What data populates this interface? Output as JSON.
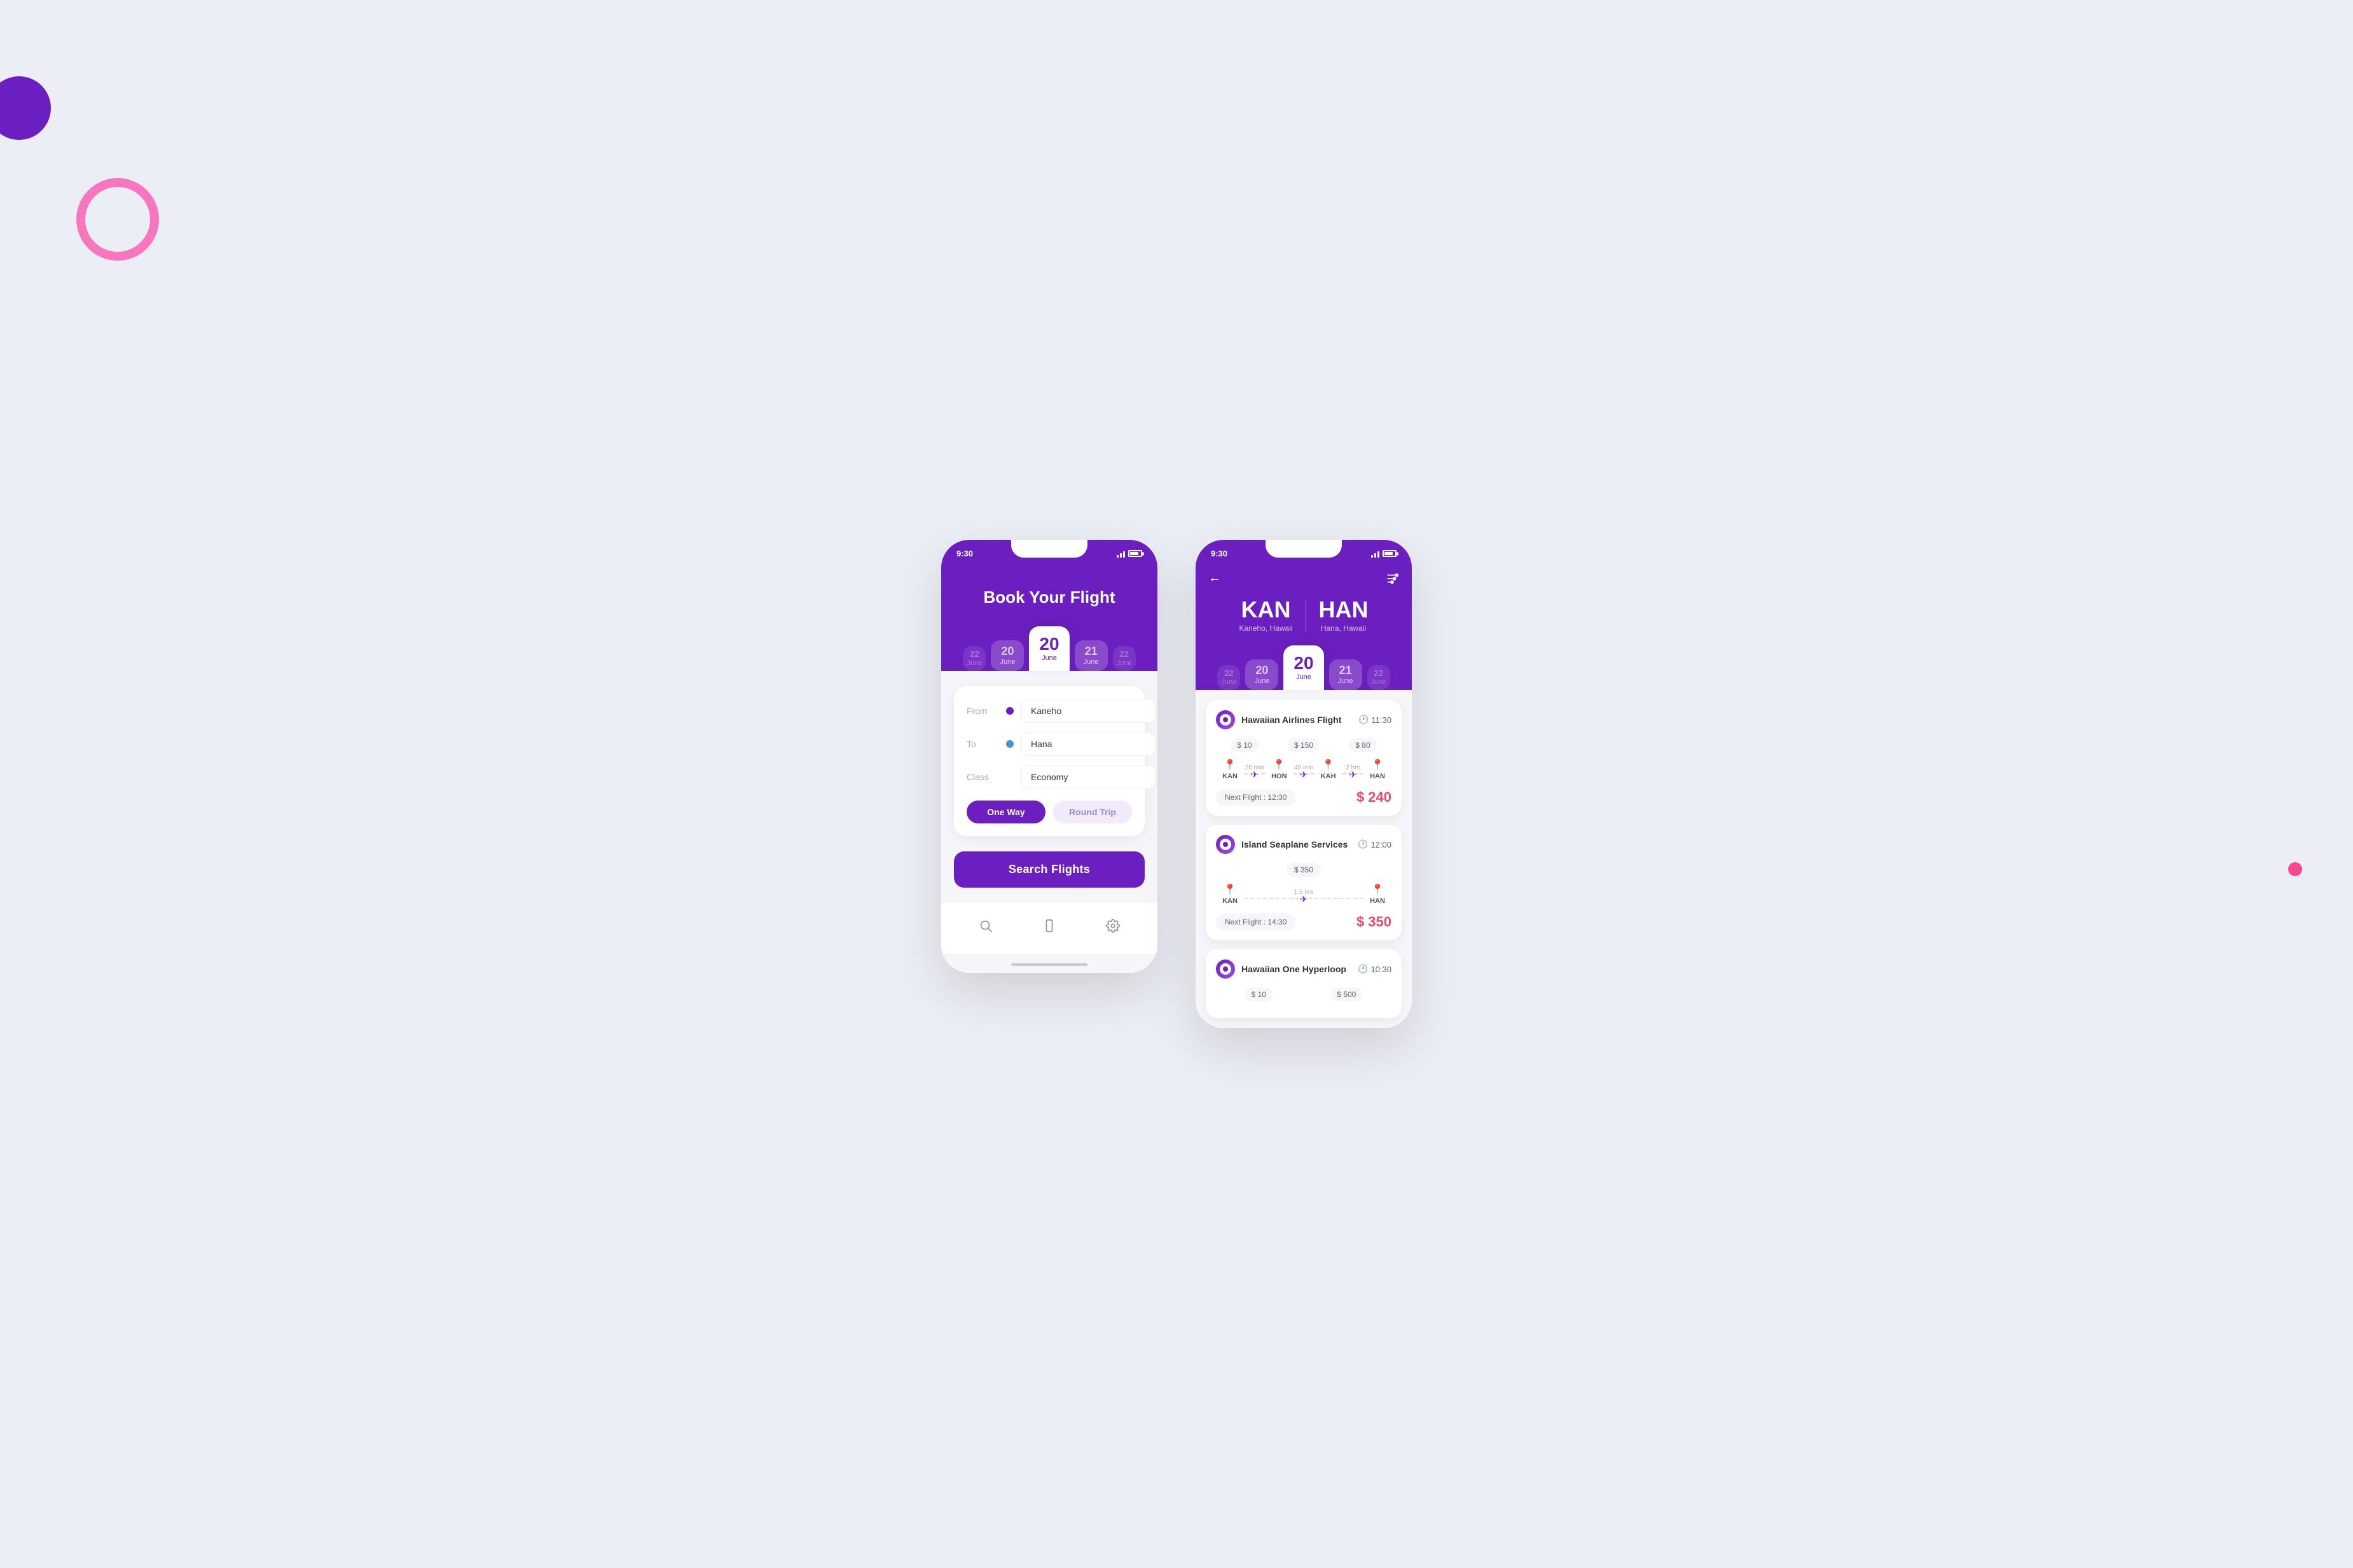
{
  "page": {
    "bg_color": "#eceef5"
  },
  "phone1": {
    "status_time": "9:30",
    "header_title": "Book Your Flight",
    "dates": [
      {
        "num": "22",
        "month": "June",
        "size": "small"
      },
      {
        "num": "20",
        "month": "June",
        "size": "normal"
      },
      {
        "num": "20",
        "month": "June",
        "size": "active"
      },
      {
        "num": "21",
        "month": "June",
        "size": "normal"
      },
      {
        "num": "22",
        "month": "June",
        "size": "small"
      }
    ],
    "form": {
      "from_label": "From",
      "from_value": "Kaneho",
      "from_placeholder": "Kaneho",
      "to_label": "To",
      "to_value": "Hana",
      "to_placeholder": "Hana",
      "class_label": "Class",
      "class_value": "Economy",
      "class_placeholder": "Economy",
      "one_way_label": "One Way",
      "round_trip_label": "Round Trip"
    },
    "search_btn_label": "Search Flights",
    "nav": {
      "search_icon": "🔍",
      "home_icon": "📱",
      "settings_icon": "⚙️"
    }
  },
  "phone2": {
    "status_time": "9:30",
    "route": {
      "from_code": "KAN",
      "from_name": "Kaneho, Hawaii",
      "to_code": "HAN",
      "to_name": "Hana, Hawaii"
    },
    "dates": [
      {
        "num": "22",
        "month": "June",
        "size": "small"
      },
      {
        "num": "20",
        "month": "June",
        "size": "normal"
      },
      {
        "num": "20",
        "month": "June",
        "size": "active"
      },
      {
        "num": "21",
        "month": "June",
        "size": "normal"
      },
      {
        "num": "22",
        "month": "June",
        "size": "small"
      }
    ],
    "flights": [
      {
        "airline": "Hawaiian Airlines Flight",
        "time": "11:30",
        "prices": [
          "$ 10",
          "$ 150",
          "$ 80"
        ],
        "stops": [
          {
            "code": "KAN",
            "duration": ""
          },
          {
            "duration": "20 min",
            "code": "HON"
          },
          {
            "duration": "40 min",
            "code": "KAH"
          },
          {
            "duration": "2 hrs",
            "code": "HAN"
          }
        ],
        "next_flight": "Next Flight : 12:30",
        "total": "$ 240"
      },
      {
        "airline": "Island Seaplane Services",
        "time": "12:00",
        "prices": [
          "$ 350"
        ],
        "stops": [
          {
            "code": "KAN",
            "duration": ""
          },
          {
            "duration": "1.5 hrs",
            "code": "HAN"
          }
        ],
        "next_flight": "Next Flight : 14:30",
        "total": "$ 350"
      },
      {
        "airline": "Hawaiian One Hyperloop",
        "time": "10:30",
        "prices": [
          "$ 10",
          "$ 500"
        ],
        "stops": [],
        "next_flight": "",
        "total": ""
      }
    ]
  }
}
